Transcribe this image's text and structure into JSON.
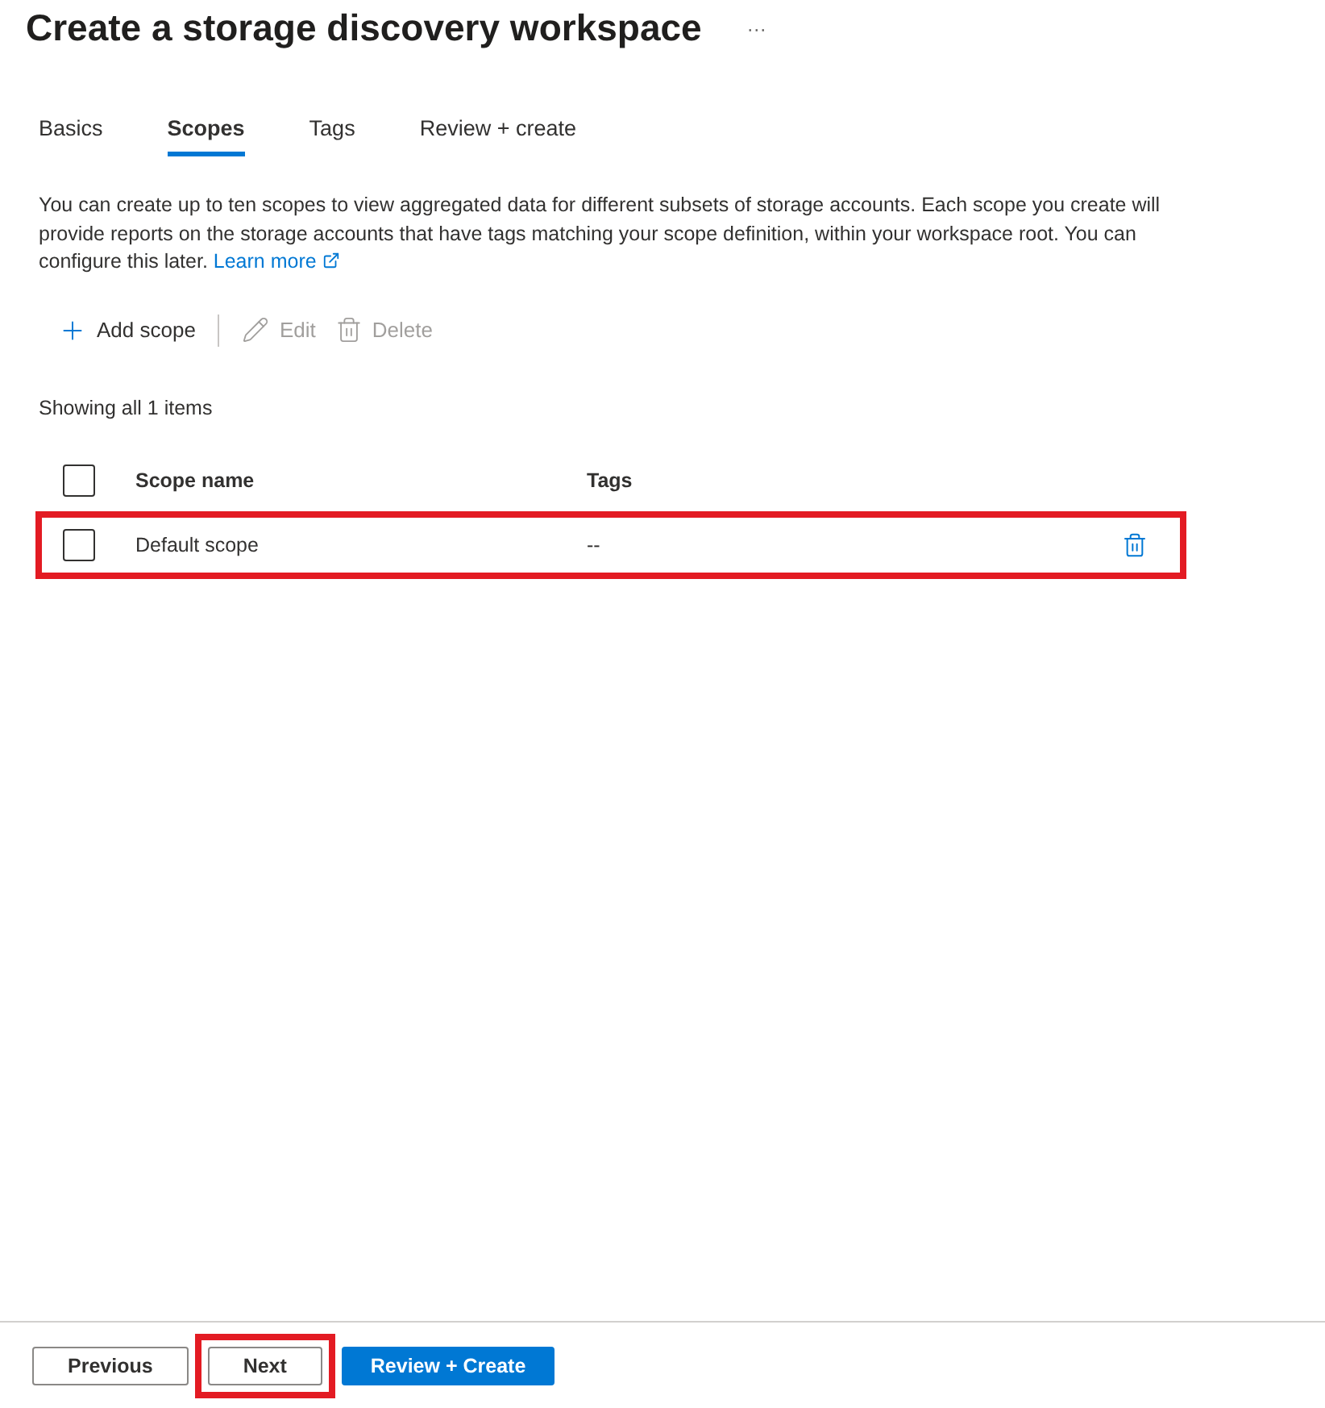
{
  "title": "Create a storage discovery workspace",
  "more": "···",
  "tabs": [
    {
      "label": "Basics",
      "selected": false
    },
    {
      "label": "Scopes",
      "selected": true
    },
    {
      "label": "Tags",
      "selected": false
    },
    {
      "label": "Review + create",
      "selected": false
    }
  ],
  "description": "You can create up to ten scopes to view aggregated data for different subsets of storage accounts. Each scope you create will provide reports on the storage accounts that have tags matching your scope definition, within your workspace root. You can configure this later.",
  "learn_more": "Learn more",
  "toolbar": [
    {
      "kind": "add",
      "label": "Add scope",
      "disabled": false
    },
    {
      "kind": "edit",
      "label": "Edit",
      "disabled": true
    },
    {
      "kind": "delete",
      "label": "Delete",
      "disabled": true
    }
  ],
  "count": "Showing all 1 items",
  "table": {
    "select_all": {
      "checked": false
    },
    "columns": [
      "Scope name",
      "Tags"
    ],
    "rows": [
      {
        "name": "Default scope",
        "tags": "--",
        "checked": false,
        "highlighted": true
      }
    ]
  },
  "footer": [
    {
      "label": "Previous",
      "primary": false,
      "highlighted": false
    },
    {
      "label": "Next",
      "primary": false,
      "highlighted": true
    },
    {
      "label": "Review + Create",
      "primary": true,
      "highlighted": false
    }
  ]
}
